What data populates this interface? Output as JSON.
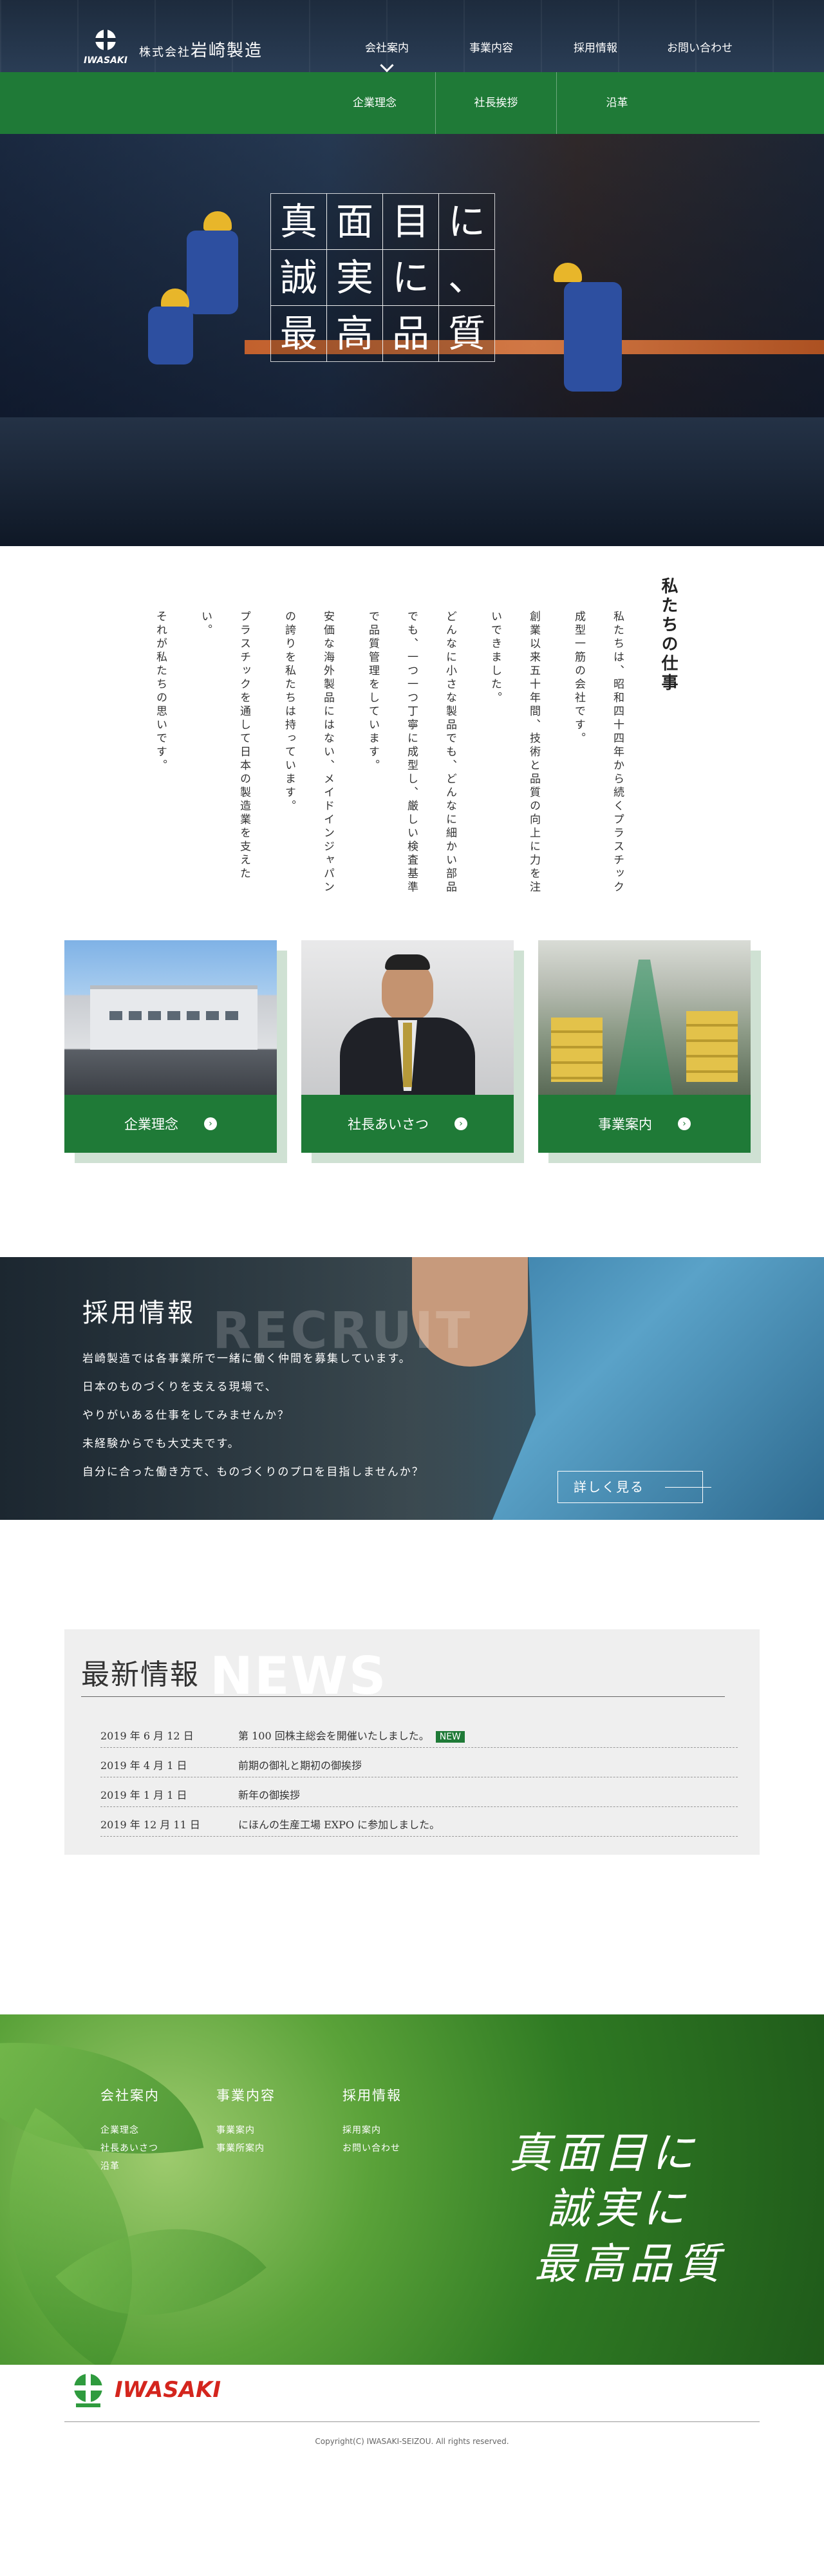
{
  "header": {
    "logo_text": "IWASAKI",
    "company_prefix": "株式会社",
    "company_name": "岩崎製造",
    "nav": [
      "会社案内",
      "事業内容",
      "採用情報",
      "お問い合わせ"
    ],
    "subnav": [
      "企業理念",
      "社長挨拶",
      "沿革"
    ]
  },
  "hero": {
    "rows": [
      [
        "真",
        "面",
        "目",
        "に"
      ],
      [
        "誠",
        "実",
        "に",
        "、"
      ],
      [
        "最",
        "高",
        "品",
        "質"
      ]
    ]
  },
  "work": {
    "title": "私たちの仕事",
    "lines": [
      "私たちは、昭和四十四年から続くプラスチック",
      "成型一筋の会社です。",
      "創業以来五十年間、技術と品質の向上に力を注",
      "いできました。",
      "どんなに小さな製品でも、どんなに細かい部品",
      "でも、一つ一つ丁寧に成型し、厳しい検査基準",
      "で品質管理をしています。",
      "安価な海外製品にはない、メイドインジャパン",
      "の誇りを私たちは持っています。",
      "プラスチックを通して日本の製造業を支えた",
      "い。",
      "それが私たちの思いです。"
    ]
  },
  "cards": [
    {
      "label": "企業理念",
      "icon": "arrow-circle-icon"
    },
    {
      "label": "社長あいさつ",
      "icon": "arrow-circle-icon"
    },
    {
      "label": "事業案内",
      "icon": "arrow-circle-icon"
    }
  ],
  "recruit": {
    "title": "採用情報",
    "bigword": "RECRUIT",
    "lines": [
      "岩崎製造では各事業所で一緒に働く仲間を募集しています。",
      "日本のものづくりを支える現場で、",
      "やりがいある仕事をしてみませんか？",
      "未経験からでも大丈夫です。",
      "自分に合った働き方で、ものづくりのプロを目指しませんか？"
    ],
    "more": "詳しく見る"
  },
  "news": {
    "title": "最新情報",
    "bigword": "NEWS",
    "items": [
      {
        "date": "2019 年 6 月 12 日",
        "text": "第 100 回株主総会を開催いたしました。",
        "badge": "NEW"
      },
      {
        "date": "2019 年 4 月 1 日",
        "text": "前期の御礼と期初の御挨拶",
        "badge": ""
      },
      {
        "date": "2019 年 1 月 1 日",
        "text": "新年の御挨拶",
        "badge": ""
      },
      {
        "date": "2019 年 12 月 11 日",
        "text": "にほんの生産工場 EXPO に参加しました。",
        "badge": ""
      }
    ]
  },
  "footer": {
    "cols": [
      {
        "title": "会社案内",
        "links": [
          "企業理念",
          "社長あいさつ",
          "沿革"
        ]
      },
      {
        "title": "事業内容",
        "links": [
          "事業案内",
          "事業所案内"
        ]
      },
      {
        "title": "採用情報",
        "links": [
          "採用案内",
          "お問い合わせ"
        ]
      }
    ],
    "hand_lines": [
      "真面目に",
      "誠実に",
      "最高品質"
    ],
    "logo_text": "IWASAKI",
    "copyright": "Copyright(C) IWASAKI-SEIZOU. All rights reserved."
  },
  "colors": {
    "brand_green": "#1f7a37",
    "logo_red": "#d4251d"
  }
}
